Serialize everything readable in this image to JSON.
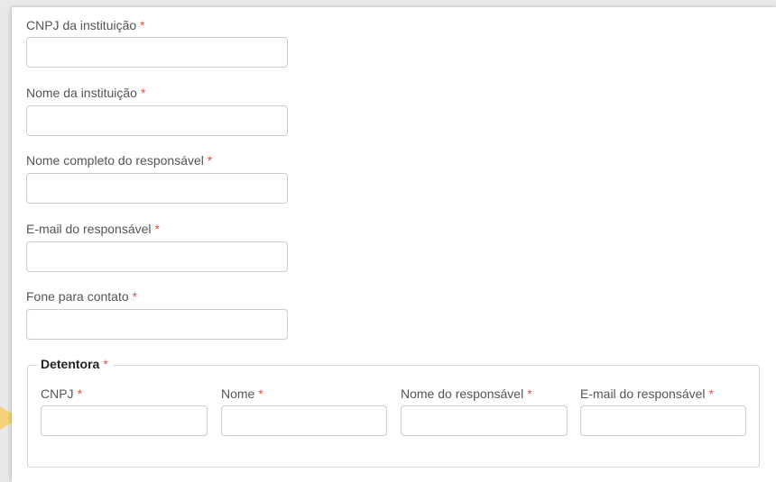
{
  "form": {
    "fields": [
      {
        "label": "CNPJ da instituição",
        "required_mark": "*",
        "value": ""
      },
      {
        "label": "Nome da instituição",
        "required_mark": "*",
        "value": ""
      },
      {
        "label": "Nome completo do responsável",
        "required_mark": "*",
        "value": ""
      },
      {
        "label": "E-mail do responsável",
        "required_mark": "*",
        "value": ""
      },
      {
        "label": "Fone para contato",
        "required_mark": "*",
        "value": ""
      }
    ],
    "detentora": {
      "legend": "Detentora",
      "required_mark": "*",
      "columns": [
        {
          "label": "CNPJ",
          "required_mark": "*",
          "value": ""
        },
        {
          "label": "Nome",
          "required_mark": "*",
          "value": ""
        },
        {
          "label": "Nome do responsável",
          "required_mark": "*",
          "value": ""
        },
        {
          "label": "E-mail do responsável",
          "required_mark": "*",
          "value": ""
        }
      ]
    }
  },
  "colors": {
    "required": "#d9534f",
    "input_border": "#cccccc",
    "pointer": "#f6d37a"
  }
}
